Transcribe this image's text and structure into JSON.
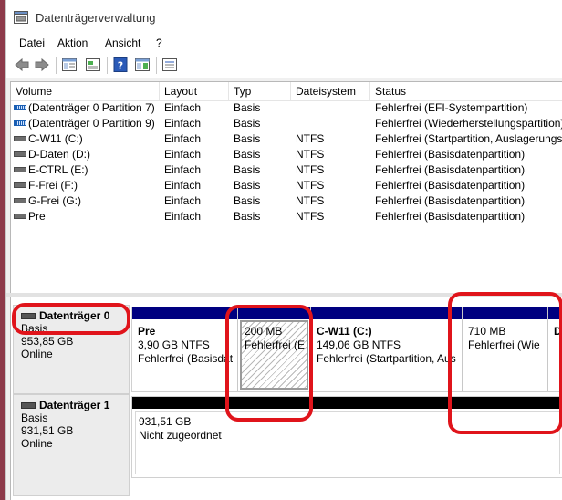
{
  "window": {
    "title": "Datenträgerverwaltung"
  },
  "menu": [
    "Datei",
    "Aktion",
    "Ansicht",
    "?"
  ],
  "toolbar": {
    "icons": [
      "back-arrow-icon",
      "forward-arrow-icon",
      "show-hide-console-tree-icon",
      "properties-icon",
      "help-icon",
      "help-topics-icon",
      "list-view-icon"
    ]
  },
  "columns": [
    "Volume",
    "Layout",
    "Typ",
    "Dateisystem",
    "Status"
  ],
  "volumes": [
    {
      "name": "(Datenträger 0 Partition 7)",
      "layout": "Einfach",
      "type": "Basis",
      "fs": "",
      "status": "Fehlerfrei (EFI-Systempartition)",
      "icon": "efi"
    },
    {
      "name": "(Datenträger 0 Partition 9)",
      "layout": "Einfach",
      "type": "Basis",
      "fs": "",
      "status": "Fehlerfrei (Wiederherstellungspartition)",
      "icon": "efi"
    },
    {
      "name": "C-W11 (C:)",
      "layout": "Einfach",
      "type": "Basis",
      "fs": "NTFS",
      "status": "Fehlerfrei (Startpartition, Auslagerungsd",
      "icon": "std"
    },
    {
      "name": "D-Daten (D:)",
      "layout": "Einfach",
      "type": "Basis",
      "fs": "NTFS",
      "status": "Fehlerfrei (Basisdatenpartition)",
      "icon": "std"
    },
    {
      "name": "E-CTRL (E:)",
      "layout": "Einfach",
      "type": "Basis",
      "fs": "NTFS",
      "status": "Fehlerfrei (Basisdatenpartition)",
      "icon": "std"
    },
    {
      "name": "F-Frei (F:)",
      "layout": "Einfach",
      "type": "Basis",
      "fs": "NTFS",
      "status": "Fehlerfrei (Basisdatenpartition)",
      "icon": "std"
    },
    {
      "name": "G-Frei (G:)",
      "layout": "Einfach",
      "type": "Basis",
      "fs": "NTFS",
      "status": "Fehlerfrei (Basisdatenpartition)",
      "icon": "std"
    },
    {
      "name": "Pre",
      "layout": "Einfach",
      "type": "Basis",
      "fs": "NTFS",
      "status": "Fehlerfrei (Basisdatenpartition)",
      "icon": "std"
    }
  ],
  "disk0": {
    "title": "Datenträger 0",
    "type": "Basis",
    "size": "953,85 GB",
    "state": "Online",
    "partitions": [
      {
        "name": "Pre",
        "size": "3,90 GB NTFS",
        "status": "Fehlerfrei (Basisdat"
      },
      {
        "name": "",
        "size": "200 MB",
        "status": "Fehlerfrei (E"
      },
      {
        "name": "C-W11  (C:)",
        "size": "149,06 GB NTFS",
        "status": "Fehlerfrei (Startpartition, Aus"
      },
      {
        "name": "",
        "size": "710 MB",
        "status": "Fehlerfrei (Wie"
      },
      {
        "name": "D",
        "size": "",
        "status": ""
      }
    ]
  },
  "disk1": {
    "title": "Datenträger 1",
    "type": "Basis",
    "size": "931,51 GB",
    "state": "Online",
    "unallocated": {
      "size": "931,51 GB",
      "status": "Nicht zugeordnet"
    }
  },
  "colors": {
    "primary_partition": "#000080",
    "unallocated": "#000000",
    "highlight": "#e0141b"
  }
}
